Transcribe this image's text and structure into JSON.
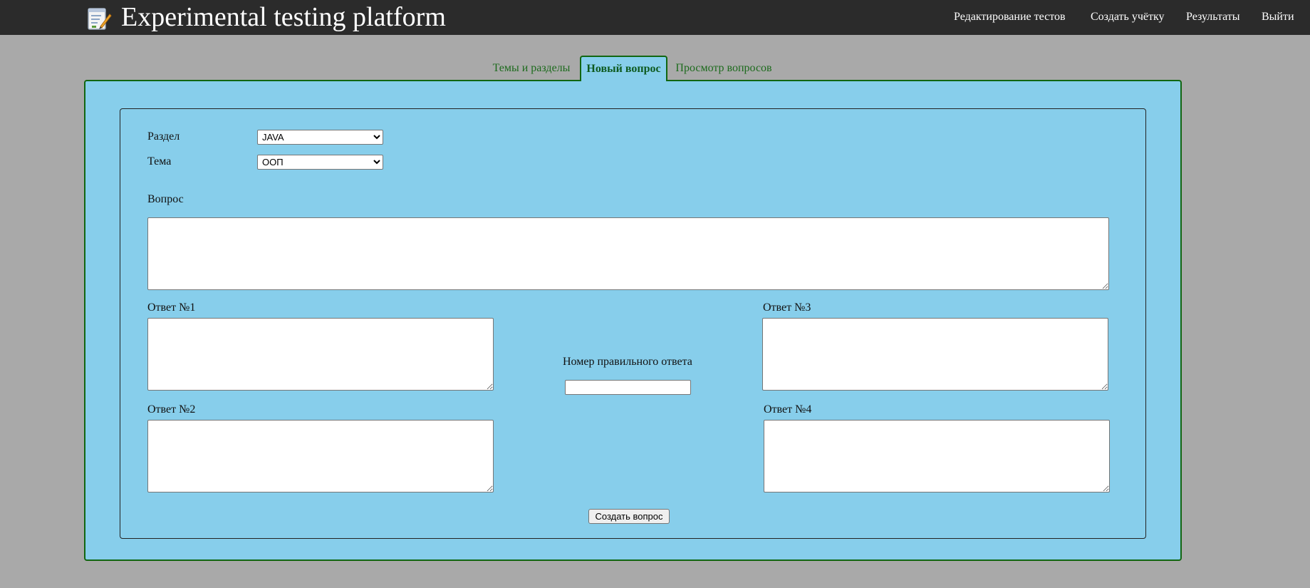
{
  "header": {
    "app_title": "Experimental testing platform",
    "logo_icon": "notepad-pencil-icon",
    "nav": [
      {
        "label": "Редактирование тестов"
      },
      {
        "label": "Создать учётку"
      },
      {
        "label": "Результаты"
      },
      {
        "label": "Выйти"
      }
    ]
  },
  "tabs": [
    {
      "label": "Темы и разделы",
      "active": false
    },
    {
      "label": "Новый вопрос",
      "active": true
    },
    {
      "label": "Просмотр вопросов",
      "active": false
    }
  ],
  "form": {
    "section_label": "Раздел",
    "section_value": "JAVA",
    "topic_label": "Тема",
    "topic_value": "ООП",
    "question_label": "Вопрос",
    "question_value": "",
    "answer1_label": "Ответ №1",
    "answer2_label": "Ответ №2",
    "answer3_label": "Ответ №3",
    "answer4_label": "Ответ №4",
    "correct_answer_label": "Номер правильного ответа",
    "correct_answer_value": "",
    "submit_label": "Создать вопрос"
  },
  "colors": {
    "topbar": "#2b2b2b",
    "page_background": "#a9a9a9",
    "panel_background": "#87ceeb",
    "panel_border": "#116611",
    "tab_text": "#1d6b1d"
  }
}
